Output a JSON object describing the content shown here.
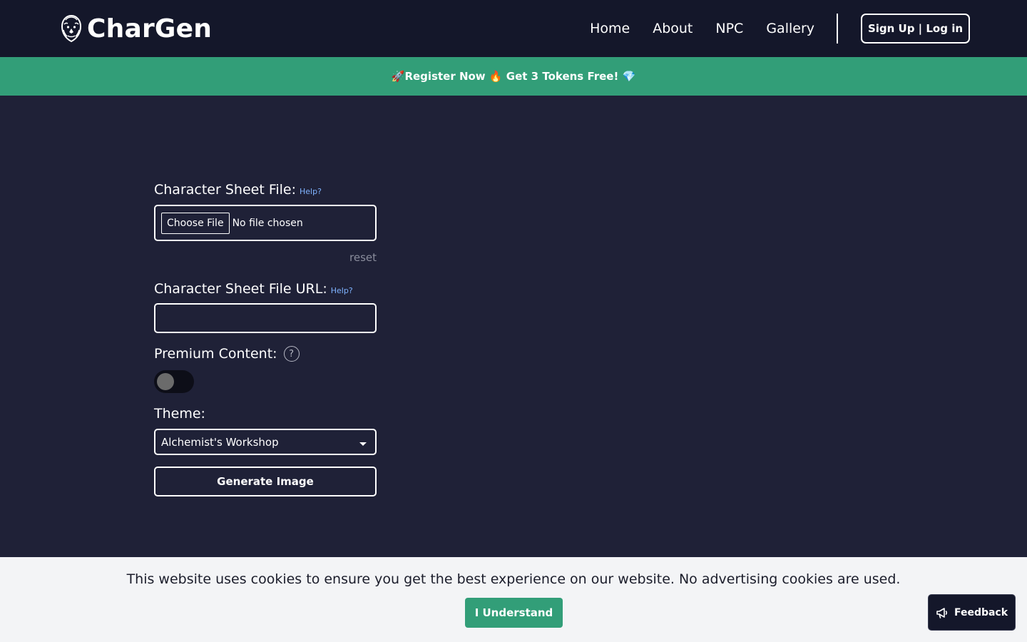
{
  "header": {
    "brand": "CharGen",
    "logo_icon": "lion-head-logo-icon",
    "nav": [
      {
        "label": "Home"
      },
      {
        "label": "About"
      },
      {
        "label": "NPC"
      },
      {
        "label": "Gallery"
      }
    ],
    "auth_label": "Sign Up | Log in"
  },
  "promo": {
    "text": "🚀Register Now 🔥 Get 3 Tokens Free! 💎"
  },
  "form": {
    "file": {
      "label": "Character Sheet File:",
      "help": "Help?",
      "button": "Choose File",
      "status": "No file chosen",
      "reset": "reset"
    },
    "url": {
      "label": "Character Sheet File URL:",
      "help": "Help?",
      "value": ""
    },
    "premium": {
      "label": "Premium Content:",
      "help_glyph": "?",
      "enabled": false
    },
    "theme": {
      "label": "Theme:",
      "selected": "Alchemist's Workshop"
    },
    "generate_label": "Generate Image"
  },
  "cookie": {
    "text": "This website uses cookies to ensure you get the best experience on our website. No advertising cookies are used.",
    "button": "I Understand"
  },
  "feedback": {
    "label": "Feedback",
    "icon": "megaphone-icon"
  },
  "colors": {
    "background": "#1f2137",
    "header": "#14172a",
    "accent_green": "#329e78",
    "help_link": "#7fb3ff"
  }
}
